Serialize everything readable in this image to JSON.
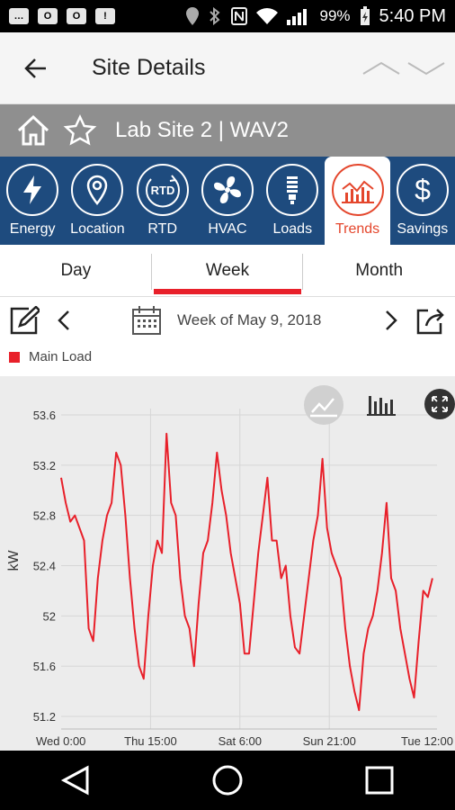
{
  "status": {
    "battery": "99%",
    "time": "5:40 PM"
  },
  "header": {
    "title": "Site Details"
  },
  "site": {
    "name": "Lab Site 2 | WAV2"
  },
  "tabs": [
    {
      "label": "Energy",
      "icon": "lightning-icon"
    },
    {
      "label": "Location",
      "icon": "location-pin-icon"
    },
    {
      "label": "RTD",
      "icon": "rtd-icon"
    },
    {
      "label": "HVAC",
      "icon": "fan-icon"
    },
    {
      "label": "Loads",
      "icon": "lightbulb-icon"
    },
    {
      "label": "Trends",
      "icon": "bar-chart-icon"
    },
    {
      "label": "Savings",
      "icon": "dollar-icon"
    }
  ],
  "active_tab": "Trends",
  "periods": [
    "Day",
    "Week",
    "Month"
  ],
  "active_period": "Week",
  "date_label": "Week of May 9, 2018",
  "colors": {
    "accent": "#e8202a",
    "tabbar": "#1e4b7e",
    "active_tab_text": "#e4462c"
  },
  "chart_data": {
    "type": "line",
    "ylabel": "kW",
    "ylim": [
      51.1,
      53.65
    ],
    "yticks": [
      "53.6",
      "53.2",
      "52.8",
      "52.4",
      "52",
      "51.6",
      "51.2"
    ],
    "xticks": [
      "Wed 0:00",
      "Thu 15:00",
      "Sat 6:00",
      "Sun 21:00",
      "Tue 12:00"
    ],
    "series": [
      {
        "name": "Main Load",
        "x_hours": [
          0,
          2,
          4,
          6,
          8,
          10,
          12,
          14,
          16,
          18,
          20,
          22,
          24,
          26,
          28,
          30,
          32,
          34,
          36,
          38,
          40,
          42,
          44,
          46,
          48,
          50,
          52,
          54,
          56,
          58,
          60,
          62,
          64,
          66,
          68,
          70,
          72,
          74,
          76,
          78,
          80,
          82,
          84,
          86,
          88,
          90,
          92,
          94,
          96,
          98,
          100,
          102,
          104,
          106,
          108,
          110,
          112,
          114,
          116,
          118,
          120,
          122,
          124,
          126,
          128,
          130,
          132,
          134,
          136,
          138,
          140,
          142,
          144,
          146,
          148,
          150,
          152,
          154,
          156,
          158,
          160,
          162
        ],
        "values": [
          53.1,
          52.9,
          52.75,
          52.8,
          52.7,
          52.6,
          51.9,
          51.8,
          52.3,
          52.6,
          52.8,
          52.9,
          53.3,
          53.2,
          52.8,
          52.3,
          51.9,
          51.6,
          51.5,
          52.0,
          52.4,
          52.6,
          52.5,
          53.45,
          52.9,
          52.8,
          52.3,
          52.0,
          51.9,
          51.6,
          52.1,
          52.5,
          52.6,
          52.9,
          53.3,
          53.0,
          52.8,
          52.5,
          52.3,
          52.1,
          51.7,
          51.7,
          52.1,
          52.5,
          52.8,
          53.1,
          52.6,
          52.6,
          52.3,
          52.4,
          52.0,
          51.75,
          51.7,
          52.0,
          52.3,
          52.6,
          52.8,
          53.25,
          52.7,
          52.5,
          52.4,
          52.3,
          51.9,
          51.6,
          51.4,
          51.25,
          51.7,
          51.9,
          52.0,
          52.2,
          52.5,
          52.9,
          52.3,
          52.2,
          51.9,
          51.7,
          51.5,
          51.35,
          51.8,
          52.2,
          52.15,
          52.3
        ]
      }
    ],
    "grid": true,
    "legend": "top-left",
    "x_range_hours": [
      0,
      164
    ]
  }
}
